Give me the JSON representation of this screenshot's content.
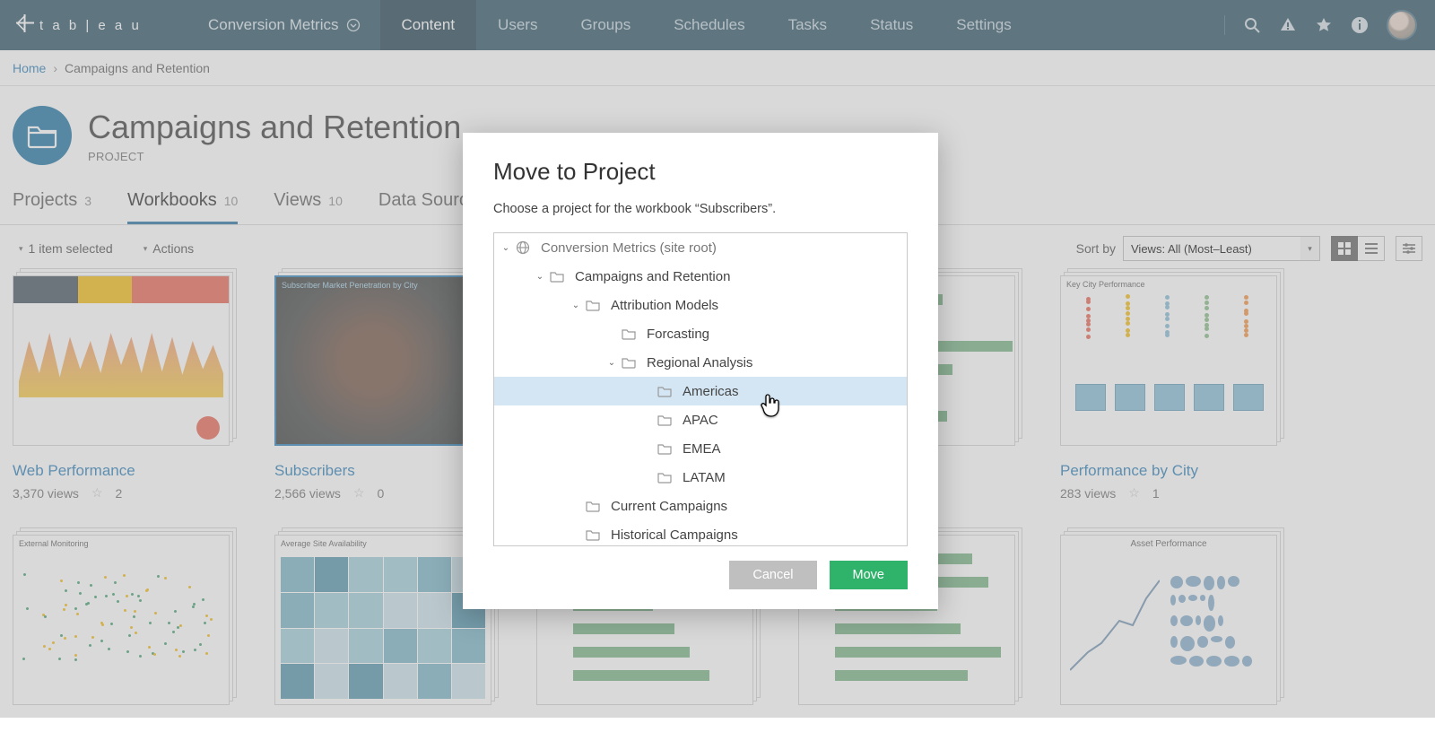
{
  "nav": {
    "site": "Conversion Metrics",
    "tabs": [
      "Content",
      "Users",
      "Groups",
      "Schedules",
      "Tasks",
      "Status",
      "Settings"
    ],
    "active_tab": "Content"
  },
  "breadcrumb": {
    "home": "Home",
    "current": "Campaigns and Retention"
  },
  "page": {
    "title": "Campaigns and Retention",
    "subtitle": "PROJECT"
  },
  "content_tabs": [
    {
      "label": "Projects",
      "count": "3"
    },
    {
      "label": "Workbooks",
      "count": "10"
    },
    {
      "label": "Views",
      "count": "10"
    },
    {
      "label": "Data Sources",
      "count": ""
    }
  ],
  "content_active": "Workbooks",
  "toolbar": {
    "selected": "1 item selected",
    "actions": "Actions",
    "sort_label": "Sort by",
    "sort_value": "Views: All (Most–Least)"
  },
  "cards": [
    {
      "title": "Web Performance",
      "views": "3,370 views",
      "fav": "2",
      "selected": false,
      "thumb_label": "Web Performance"
    },
    {
      "title": "Subscribers",
      "views": "2,566 views",
      "fav": "0",
      "selected": true,
      "thumb_label": "Subscriber Market Penetration by City"
    },
    {
      "title": "",
      "views": "",
      "fav": "",
      "selected": false,
      "thumb_label": ""
    },
    {
      "title": "",
      "views": "",
      "fav": "",
      "selected": false,
      "thumb_label": ""
    },
    {
      "title": "Performance by City",
      "views": "283 views",
      "fav": "1",
      "selected": false,
      "thumb_label": "Key City Performance"
    },
    {
      "title": "",
      "views": "",
      "fav": "",
      "selected": false,
      "thumb_label": "External Monitoring"
    },
    {
      "title": "",
      "views": "",
      "fav": "",
      "selected": false,
      "thumb_label": "Average Site Availability"
    },
    {
      "title": "",
      "views": "",
      "fav": "",
      "selected": false,
      "thumb_label": ""
    },
    {
      "title": "",
      "views": "",
      "fav": "",
      "selected": false,
      "thumb_label": ""
    },
    {
      "title": "",
      "views": "",
      "fav": "",
      "selected": false,
      "thumb_label": "Asset Performance"
    }
  ],
  "modal": {
    "title": "Move to Project",
    "prompt": "Choose a project for the workbook “Subscribers”.",
    "root": "Conversion Metrics (site root)",
    "tree": [
      {
        "indent": 1,
        "label": "Campaigns and Retention",
        "expandable": true,
        "open": true
      },
      {
        "indent": 2,
        "label": "Attribution Models",
        "expandable": true,
        "open": true
      },
      {
        "indent": 3,
        "label": "Forcasting",
        "expandable": false
      },
      {
        "indent": 3,
        "label": "Regional Analysis",
        "expandable": true,
        "open": true
      },
      {
        "indent": 4,
        "label": "Americas",
        "expandable": false,
        "hover": true
      },
      {
        "indent": 4,
        "label": "APAC",
        "expandable": false
      },
      {
        "indent": 4,
        "label": "EMEA",
        "expandable": false
      },
      {
        "indent": 4,
        "label": "LATAM",
        "expandable": false
      },
      {
        "indent": 2,
        "label": "Current Campaigns",
        "expandable": false
      },
      {
        "indent": 2,
        "label": "Historical Campaigns",
        "expandable": false
      }
    ],
    "cancel": "Cancel",
    "move": "Move"
  }
}
